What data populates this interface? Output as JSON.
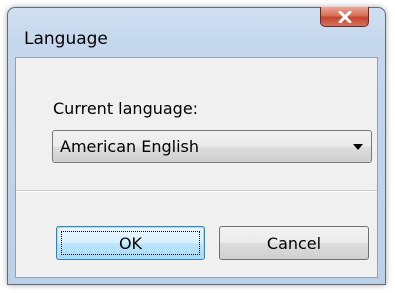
{
  "window": {
    "title": "Language",
    "close_label": "Close"
  },
  "form": {
    "label": "Current language:",
    "selected_language": "American English"
  },
  "buttons": {
    "ok": "OK",
    "cancel": "Cancel"
  },
  "icons": {
    "close": "close-icon",
    "dropdown": "chevron-down-icon"
  },
  "colors": {
    "close_button": "#c4452c",
    "ok_button_border": "#3c7fb1",
    "title_bar": "#bcd1e8"
  }
}
